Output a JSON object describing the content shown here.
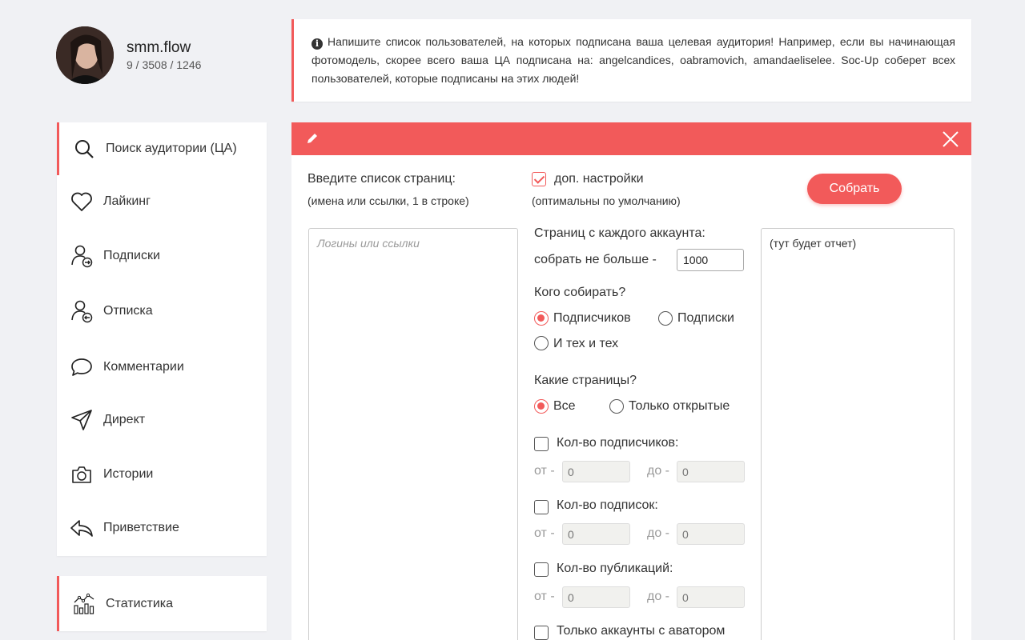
{
  "profile": {
    "username": "smm.flow",
    "stats": "9 / 3508 / 1246"
  },
  "info": {
    "text": "Напишите список пользователей, на которых подписана ваша целевая аудитория! Например, если вы начинающая фотомодель, скорее всего ваша ЦА подписана на: angelcandices, oabramovich, amandaeliselee. Soc-Up соберет всех пользователей, которые подписаны на этих людей!"
  },
  "sidebar": {
    "items": [
      {
        "label": "Поиск аудитории (ЦА)",
        "icon": "search-icon"
      },
      {
        "label": "Лайкинг",
        "icon": "heart-icon"
      },
      {
        "label": "Подписки",
        "icon": "user-follow-icon"
      },
      {
        "label": "Отписка",
        "icon": "user-unfollow-icon"
      },
      {
        "label": "Комментарии",
        "icon": "comment-icon"
      },
      {
        "label": "Директ",
        "icon": "send-icon"
      },
      {
        "label": "Истории",
        "icon": "camera-icon"
      },
      {
        "label": "Приветствие",
        "icon": "reply-icon"
      }
    ],
    "stats_label": "Статистика"
  },
  "panel": {
    "pages_label": "Введите список страниц:",
    "pages_hint": "(имена или ссылки, 1 в строке)",
    "pages_placeholder": "Логины или ссылки",
    "extra_label": "доп. настройки",
    "extra_hint": "(оптимальны по умолчанию)",
    "collect_button": "Собрать",
    "report_placeholder": "(тут будет отчет)",
    "per_account_label": "Страниц с каждого аккаунта:",
    "max_label": "собрать не больше -",
    "max_value": "1000",
    "who_label": "Кого собирать?",
    "who_options": [
      "Подписчиков",
      "Подписки",
      "И тех и тех"
    ],
    "which_label": "Какие страницы?",
    "which_options": [
      "Все",
      "Только открытые"
    ],
    "followers_label": "Кол-во подписчиков:",
    "following_label": "Кол-во подписок:",
    "posts_label": "Кол-во публикаций:",
    "avatar_label": "Только аккаунты с аватором",
    "from_label": "от -",
    "to_label": "до -",
    "range_placeholder": "0"
  },
  "colors": {
    "accent": "#f25a5a"
  }
}
